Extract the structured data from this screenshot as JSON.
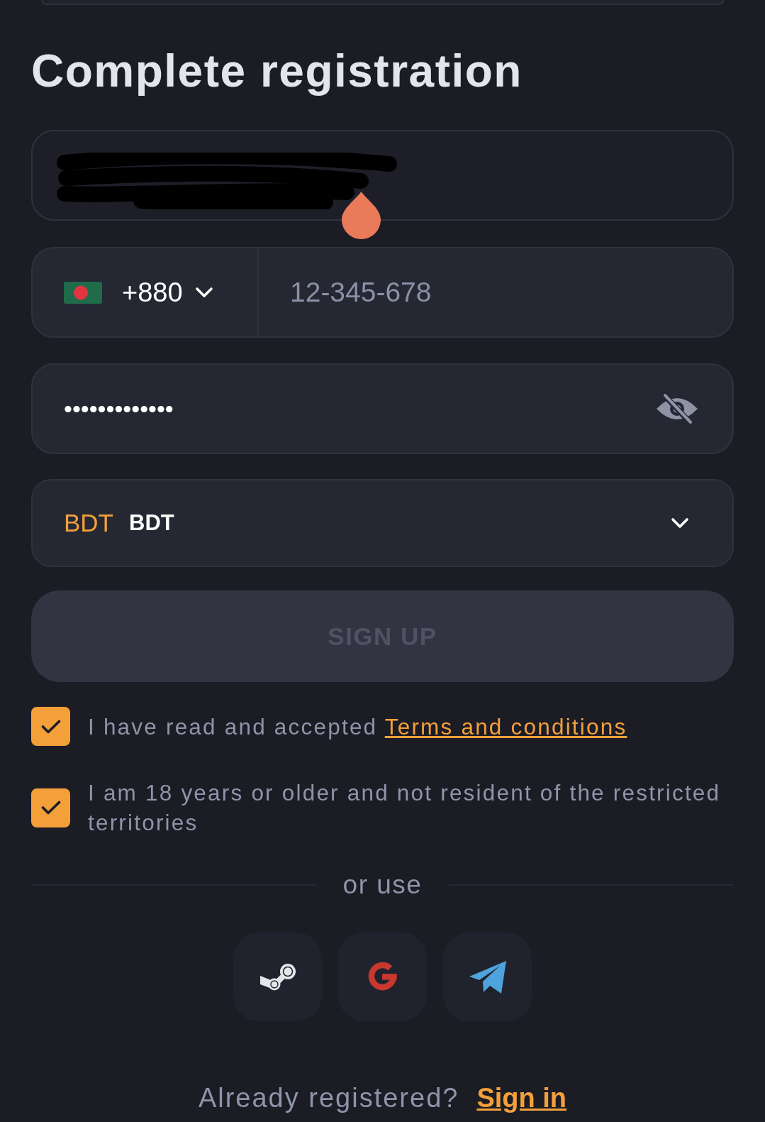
{
  "title": "Complete registration",
  "email_field": {
    "redacted": true,
    "selection_handle": true
  },
  "phone": {
    "country_code": "+880",
    "placeholder": "12-345-678"
  },
  "password": {
    "value": "•••••••••••••",
    "visible": false
  },
  "currency": {
    "code": "BDT",
    "name": "BDT"
  },
  "sign_up": {
    "label": "SIGN UP",
    "disabled": true
  },
  "agreements": [
    {
      "text": "I have read and accepted",
      "link": "Terms and conditions",
      "checked": true
    },
    {
      "text": "I am 18 years or older and not resident of the restricted territories",
      "checked": true
    }
  ],
  "social_login": {
    "label": "or use",
    "buttons": [
      {
        "kind": "steam"
      },
      {
        "kind": "google"
      },
      {
        "kind": "telegram"
      }
    ]
  },
  "footer": {
    "text": "Already registered?",
    "link": "Sign in"
  }
}
